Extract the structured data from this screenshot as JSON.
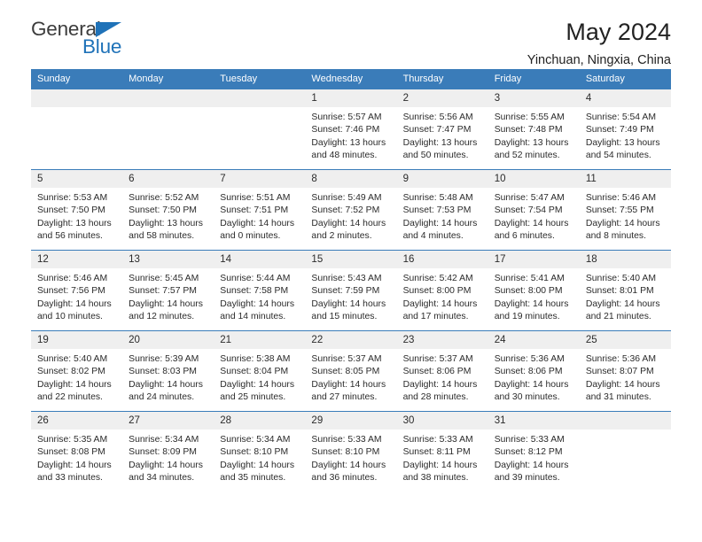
{
  "brand": {
    "name_part1": "General",
    "name_part2": "Blue",
    "accent_color": "#1f72b8",
    "triangle_icon": "triangle-logo-icon"
  },
  "header": {
    "month_title": "May 2024",
    "location": "Yinchuan, Ningxia, China"
  },
  "theme": {
    "header_row_bg": "#3a7cb9",
    "daynum_bg": "#efefef",
    "grid_line": "#3a7cb9",
    "text": "#2b2b2b"
  },
  "weekday_headers": [
    "Sunday",
    "Monday",
    "Tuesday",
    "Wednesday",
    "Thursday",
    "Friday",
    "Saturday"
  ],
  "weeks": [
    [
      {
        "day": "",
        "empty": true,
        "sunrise": "",
        "sunset": "",
        "daylight_line1": "",
        "daylight_line2": ""
      },
      {
        "day": "",
        "empty": true,
        "sunrise": "",
        "sunset": "",
        "daylight_line1": "",
        "daylight_line2": ""
      },
      {
        "day": "",
        "empty": true,
        "sunrise": "",
        "sunset": "",
        "daylight_line1": "",
        "daylight_line2": ""
      },
      {
        "day": "1",
        "empty": false,
        "sunrise": "Sunrise: 5:57 AM",
        "sunset": "Sunset: 7:46 PM",
        "daylight_line1": "Daylight: 13 hours",
        "daylight_line2": "and 48 minutes."
      },
      {
        "day": "2",
        "empty": false,
        "sunrise": "Sunrise: 5:56 AM",
        "sunset": "Sunset: 7:47 PM",
        "daylight_line1": "Daylight: 13 hours",
        "daylight_line2": "and 50 minutes."
      },
      {
        "day": "3",
        "empty": false,
        "sunrise": "Sunrise: 5:55 AM",
        "sunset": "Sunset: 7:48 PM",
        "daylight_line1": "Daylight: 13 hours",
        "daylight_line2": "and 52 minutes."
      },
      {
        "day": "4",
        "empty": false,
        "sunrise": "Sunrise: 5:54 AM",
        "sunset": "Sunset: 7:49 PM",
        "daylight_line1": "Daylight: 13 hours",
        "daylight_line2": "and 54 minutes."
      }
    ],
    [
      {
        "day": "5",
        "empty": false,
        "sunrise": "Sunrise: 5:53 AM",
        "sunset": "Sunset: 7:50 PM",
        "daylight_line1": "Daylight: 13 hours",
        "daylight_line2": "and 56 minutes."
      },
      {
        "day": "6",
        "empty": false,
        "sunrise": "Sunrise: 5:52 AM",
        "sunset": "Sunset: 7:50 PM",
        "daylight_line1": "Daylight: 13 hours",
        "daylight_line2": "and 58 minutes."
      },
      {
        "day": "7",
        "empty": false,
        "sunrise": "Sunrise: 5:51 AM",
        "sunset": "Sunset: 7:51 PM",
        "daylight_line1": "Daylight: 14 hours",
        "daylight_line2": "and 0 minutes."
      },
      {
        "day": "8",
        "empty": false,
        "sunrise": "Sunrise: 5:49 AM",
        "sunset": "Sunset: 7:52 PM",
        "daylight_line1": "Daylight: 14 hours",
        "daylight_line2": "and 2 minutes."
      },
      {
        "day": "9",
        "empty": false,
        "sunrise": "Sunrise: 5:48 AM",
        "sunset": "Sunset: 7:53 PM",
        "daylight_line1": "Daylight: 14 hours",
        "daylight_line2": "and 4 minutes."
      },
      {
        "day": "10",
        "empty": false,
        "sunrise": "Sunrise: 5:47 AM",
        "sunset": "Sunset: 7:54 PM",
        "daylight_line1": "Daylight: 14 hours",
        "daylight_line2": "and 6 minutes."
      },
      {
        "day": "11",
        "empty": false,
        "sunrise": "Sunrise: 5:46 AM",
        "sunset": "Sunset: 7:55 PM",
        "daylight_line1": "Daylight: 14 hours",
        "daylight_line2": "and 8 minutes."
      }
    ],
    [
      {
        "day": "12",
        "empty": false,
        "sunrise": "Sunrise: 5:46 AM",
        "sunset": "Sunset: 7:56 PM",
        "daylight_line1": "Daylight: 14 hours",
        "daylight_line2": "and 10 minutes."
      },
      {
        "day": "13",
        "empty": false,
        "sunrise": "Sunrise: 5:45 AM",
        "sunset": "Sunset: 7:57 PM",
        "daylight_line1": "Daylight: 14 hours",
        "daylight_line2": "and 12 minutes."
      },
      {
        "day": "14",
        "empty": false,
        "sunrise": "Sunrise: 5:44 AM",
        "sunset": "Sunset: 7:58 PM",
        "daylight_line1": "Daylight: 14 hours",
        "daylight_line2": "and 14 minutes."
      },
      {
        "day": "15",
        "empty": false,
        "sunrise": "Sunrise: 5:43 AM",
        "sunset": "Sunset: 7:59 PM",
        "daylight_line1": "Daylight: 14 hours",
        "daylight_line2": "and 15 minutes."
      },
      {
        "day": "16",
        "empty": false,
        "sunrise": "Sunrise: 5:42 AM",
        "sunset": "Sunset: 8:00 PM",
        "daylight_line1": "Daylight: 14 hours",
        "daylight_line2": "and 17 minutes."
      },
      {
        "day": "17",
        "empty": false,
        "sunrise": "Sunrise: 5:41 AM",
        "sunset": "Sunset: 8:00 PM",
        "daylight_line1": "Daylight: 14 hours",
        "daylight_line2": "and 19 minutes."
      },
      {
        "day": "18",
        "empty": false,
        "sunrise": "Sunrise: 5:40 AM",
        "sunset": "Sunset: 8:01 PM",
        "daylight_line1": "Daylight: 14 hours",
        "daylight_line2": "and 21 minutes."
      }
    ],
    [
      {
        "day": "19",
        "empty": false,
        "sunrise": "Sunrise: 5:40 AM",
        "sunset": "Sunset: 8:02 PM",
        "daylight_line1": "Daylight: 14 hours",
        "daylight_line2": "and 22 minutes."
      },
      {
        "day": "20",
        "empty": false,
        "sunrise": "Sunrise: 5:39 AM",
        "sunset": "Sunset: 8:03 PM",
        "daylight_line1": "Daylight: 14 hours",
        "daylight_line2": "and 24 minutes."
      },
      {
        "day": "21",
        "empty": false,
        "sunrise": "Sunrise: 5:38 AM",
        "sunset": "Sunset: 8:04 PM",
        "daylight_line1": "Daylight: 14 hours",
        "daylight_line2": "and 25 minutes."
      },
      {
        "day": "22",
        "empty": false,
        "sunrise": "Sunrise: 5:37 AM",
        "sunset": "Sunset: 8:05 PM",
        "daylight_line1": "Daylight: 14 hours",
        "daylight_line2": "and 27 minutes."
      },
      {
        "day": "23",
        "empty": false,
        "sunrise": "Sunrise: 5:37 AM",
        "sunset": "Sunset: 8:06 PM",
        "daylight_line1": "Daylight: 14 hours",
        "daylight_line2": "and 28 minutes."
      },
      {
        "day": "24",
        "empty": false,
        "sunrise": "Sunrise: 5:36 AM",
        "sunset": "Sunset: 8:06 PM",
        "daylight_line1": "Daylight: 14 hours",
        "daylight_line2": "and 30 minutes."
      },
      {
        "day": "25",
        "empty": false,
        "sunrise": "Sunrise: 5:36 AM",
        "sunset": "Sunset: 8:07 PM",
        "daylight_line1": "Daylight: 14 hours",
        "daylight_line2": "and 31 minutes."
      }
    ],
    [
      {
        "day": "26",
        "empty": false,
        "sunrise": "Sunrise: 5:35 AM",
        "sunset": "Sunset: 8:08 PM",
        "daylight_line1": "Daylight: 14 hours",
        "daylight_line2": "and 33 minutes."
      },
      {
        "day": "27",
        "empty": false,
        "sunrise": "Sunrise: 5:34 AM",
        "sunset": "Sunset: 8:09 PM",
        "daylight_line1": "Daylight: 14 hours",
        "daylight_line2": "and 34 minutes."
      },
      {
        "day": "28",
        "empty": false,
        "sunrise": "Sunrise: 5:34 AM",
        "sunset": "Sunset: 8:10 PM",
        "daylight_line1": "Daylight: 14 hours",
        "daylight_line2": "and 35 minutes."
      },
      {
        "day": "29",
        "empty": false,
        "sunrise": "Sunrise: 5:33 AM",
        "sunset": "Sunset: 8:10 PM",
        "daylight_line1": "Daylight: 14 hours",
        "daylight_line2": "and 36 minutes."
      },
      {
        "day": "30",
        "empty": false,
        "sunrise": "Sunrise: 5:33 AM",
        "sunset": "Sunset: 8:11 PM",
        "daylight_line1": "Daylight: 14 hours",
        "daylight_line2": "and 38 minutes."
      },
      {
        "day": "31",
        "empty": false,
        "sunrise": "Sunrise: 5:33 AM",
        "sunset": "Sunset: 8:12 PM",
        "daylight_line1": "Daylight: 14 hours",
        "daylight_line2": "and 39 minutes."
      },
      {
        "day": "",
        "empty": true,
        "sunrise": "",
        "sunset": "",
        "daylight_line1": "",
        "daylight_line2": ""
      }
    ]
  ]
}
